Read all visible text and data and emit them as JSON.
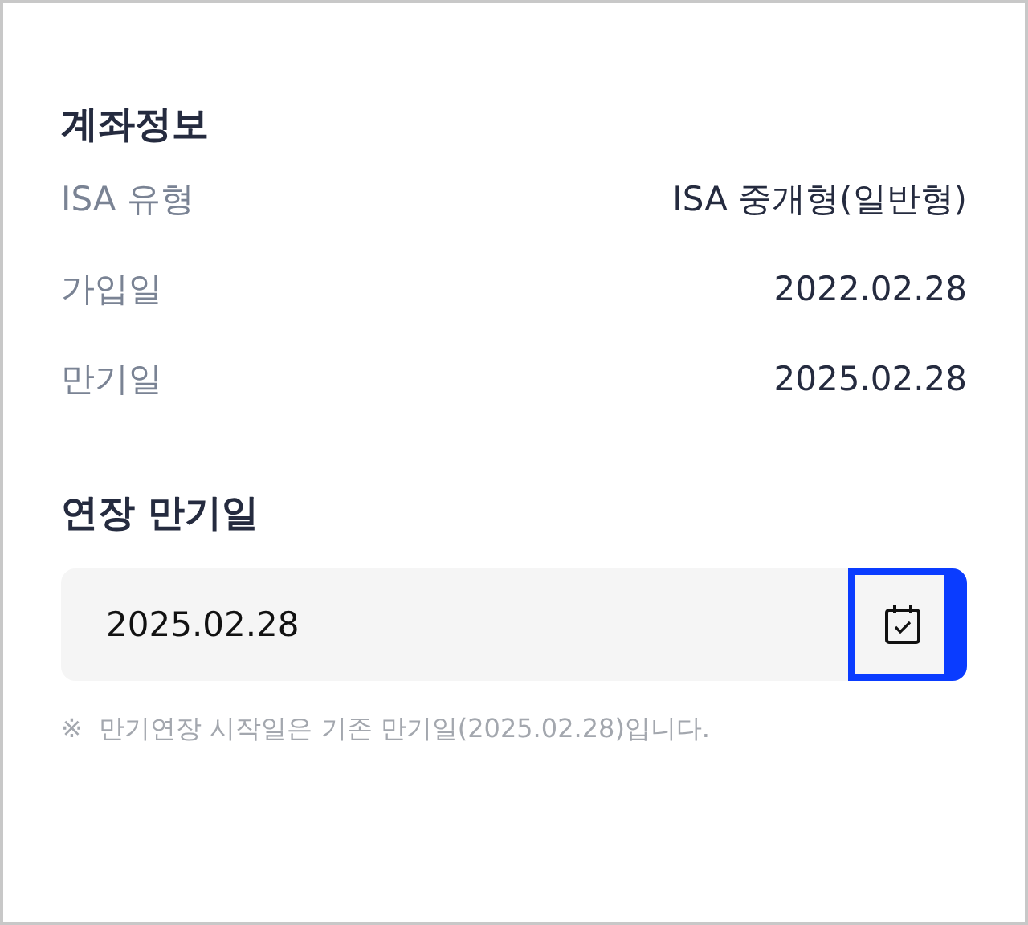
{
  "account_info": {
    "title": "계좌정보",
    "rows": [
      {
        "label": "ISA 유형",
        "value": "ISA 중개형(일반형)"
      },
      {
        "label": "가입일",
        "value": "2022.02.28"
      },
      {
        "label": "만기일",
        "value": "2025.02.28"
      }
    ]
  },
  "extension": {
    "title": "연장 만기일",
    "date_field": {
      "value": "2025.02.28"
    },
    "calendar_button": {
      "focused": true
    },
    "note": "※  만기연장 시작일은 기존 만기일(2025.02.28)입니다."
  }
}
